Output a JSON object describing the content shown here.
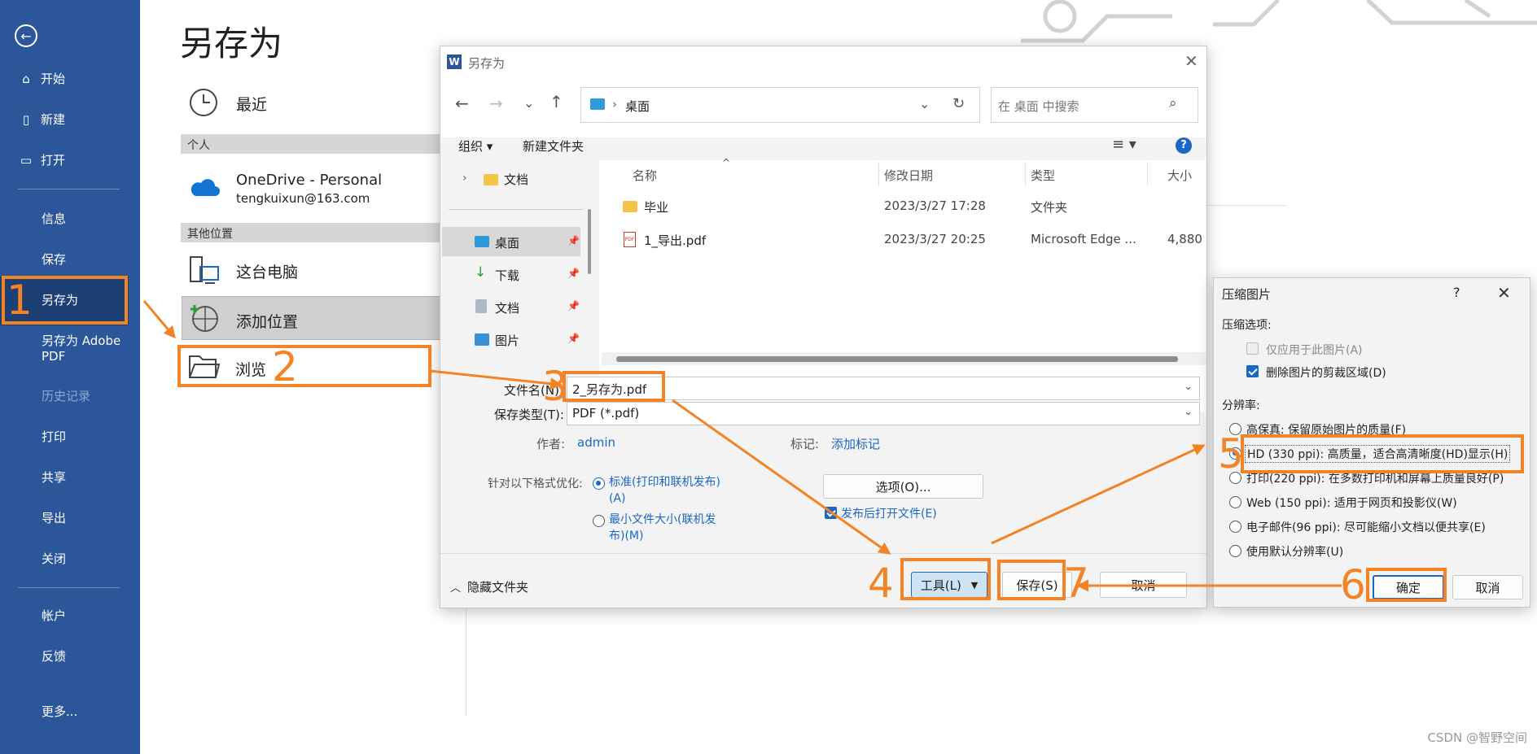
{
  "nav": {
    "items": [
      "开始",
      "新建",
      "打开",
      "信息",
      "保存",
      "另存为",
      "另存为 Adobe",
      "PDF",
      "历史记录",
      "打印",
      "共享",
      "导出",
      "关闭",
      "帐户",
      "反馈",
      "更多..."
    ]
  },
  "backstage": {
    "title": "另存为",
    "recent": "最近",
    "personal_header": "个人",
    "onedrive_name": "OneDrive - Personal",
    "onedrive_email": "tengkuixun@163.com",
    "other_header": "其他位置",
    "this_pc": "这台电脑",
    "add_place": "添加位置",
    "browse": "浏览"
  },
  "dialog": {
    "title": "另存为",
    "path_root": "桌面",
    "search_placeholder": "在 桌面 中搜索",
    "toolbar": {
      "organize": "组织 ▾",
      "new_folder": "新建文件夹"
    },
    "nav_tree": [
      "文档",
      "桌面",
      "下载",
      "文档",
      "图片"
    ],
    "columns": [
      "名称",
      "修改日期",
      "类型",
      "大小"
    ],
    "files": [
      {
        "name": "毕业",
        "date": "2023/3/27 17:28",
        "type": "文件夹",
        "size": ""
      },
      {
        "name": "1_导出.pdf",
        "date": "2023/3/27 20:25",
        "type": "Microsoft Edge ...",
        "size": "4,880"
      }
    ],
    "filename_label": "文件名(N):",
    "filename_value": "2_另存为.pdf",
    "filetype_label": "保存类型(T):",
    "filetype_value": "PDF (*.pdf)",
    "author_label": "作者:",
    "author_value": "admin",
    "tags_label": "标记:",
    "tags_value": "添加标记",
    "optimize_label": "针对以下格式优化:",
    "opt_standard_1": "标准(打印和联机发布)",
    "opt_standard_2": "(A)",
    "opt_min_1": "最小文件大小(联机发",
    "opt_min_2": "布)(M)",
    "options_button": "选项(O)...",
    "open_after": "发布后打开文件(E)",
    "hide_folders": "隐藏文件夹",
    "tools_button": "工具(L)",
    "save_button": "保存(S)",
    "cancel_button": "取消"
  },
  "compress": {
    "title": "压缩图片",
    "help": "?",
    "options_header": "压缩选项:",
    "only_this": "仅应用于此图片(A)",
    "delete_cropped": "删除图片的剪裁区域(D)",
    "resolution_header": "分辨率:",
    "res": [
      "高保真: 保留原始图片的质量(F)",
      "HD (330 ppi): 高质量，适合高清晰度(HD)显示(H)",
      "打印(220 ppi): 在多数打印机和屏幕上质量良好(P)",
      "Web (150 ppi): 适用于网页和投影仪(W)",
      "电子邮件(96 ppi): 尽可能缩小文档以便共享(E)",
      "使用默认分辨率(U)"
    ],
    "ok_button": "确定",
    "cancel_button": "取消"
  },
  "steps": [
    "1",
    "2",
    "3",
    "4",
    "5",
    "6",
    "7"
  ],
  "watermark": "CSDN @智野空间",
  "colors": {
    "nav": "#2b579a",
    "accent": "#f28327",
    "link": "#1a67c4"
  }
}
